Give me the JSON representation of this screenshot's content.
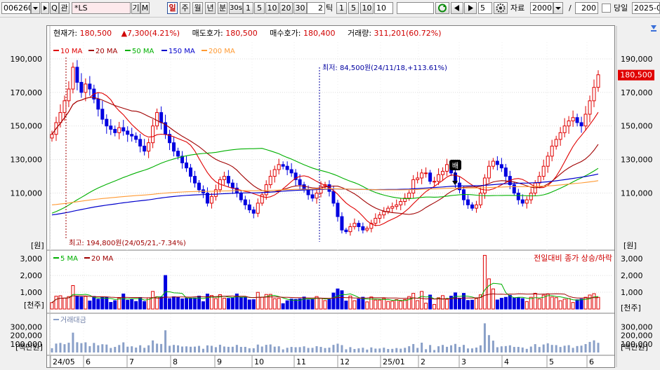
{
  "toolbar": {
    "code": "006260",
    "search_icon_glyph": "Q",
    "interest_label": "관",
    "stock_name": "*LS",
    "btn_gi": "기",
    "btn_m": "M",
    "periods": [
      "일",
      "주",
      "월",
      "년",
      "분",
      "30s"
    ],
    "selected_period": "일",
    "minute_values": [
      "1",
      "5",
      "10",
      "20",
      "30"
    ],
    "tick_input": "2",
    "tick_label": "틱",
    "tick_values": [
      "1",
      "5",
      "10"
    ],
    "tick_value2": "10",
    "blank_input": "",
    "nav_value": "5",
    "data_label": "자료",
    "data_count": "2000",
    "slash": "/",
    "view_count": "200",
    "today_label": "당일",
    "date": "2025-0"
  },
  "info": {
    "price_label": "현재가:",
    "price": "180,500",
    "change": "7,300(4.21%)",
    "ask_label": "매도호가:",
    "ask": "180,500",
    "bid_label": "매수호가:",
    "bid": "180,400",
    "volume_label": "거래량:",
    "volume": "311,201(60.72%)"
  },
  "colors": {
    "up": "#e00000",
    "down": "#0000e0",
    "ma10": "#e00000",
    "ma20": "#a00000",
    "ma50": "#00b000",
    "ma150": "#0000cc",
    "ma200": "#ff9a33"
  },
  "chart_data": [
    {
      "type": "candlestick",
      "title": "",
      "legend": [
        "10 MA",
        "20 MA",
        "50 MA",
        "150 MA",
        "200 MA"
      ],
      "ylabel": "[원]",
      "ylim": [
        81000,
        200000
      ],
      "y_ticks": [
        "190,000",
        "170,000",
        "150,000",
        "130,000",
        "110,000"
      ],
      "y_tick_values": [
        190000,
        170000,
        150000,
        130000,
        110000
      ],
      "current_price_tag": "180,500",
      "current_price_value": 180500,
      "annotations": {
        "low": "최저: 84,500원(24/11/18,+113.61%)",
        "high": "최고: 194,800원(24/05/21,-7.34%)",
        "marker": "배"
      },
      "x_labels": [
        "24/05",
        "6",
        "7",
        "8",
        "9",
        "10",
        "11",
        "12",
        "25/01",
        "2",
        "3",
        "4",
        "5",
        "6"
      ],
      "close_series": [
        145000,
        152000,
        158000,
        165000,
        172000,
        185000,
        176000,
        170000,
        175000,
        172000,
        166000,
        160000,
        154000,
        150000,
        148000,
        146000,
        149000,
        147000,
        145000,
        144000,
        142000,
        138000,
        135000,
        140000,
        150000,
        158000,
        152000,
        145000,
        140000,
        135000,
        132000,
        128000,
        125000,
        120000,
        116000,
        112000,
        110000,
        104000,
        108000,
        112000,
        118000,
        120000,
        116000,
        113000,
        110000,
        106000,
        103000,
        100000,
        98000,
        104000,
        109000,
        115000,
        120000,
        124000,
        127000,
        126000,
        124000,
        122000,
        118000,
        115000,
        112000,
        109000,
        107000,
        110000,
        114000,
        115000,
        111000,
        104000,
        96000,
        88000,
        87000,
        90000,
        92000,
        90000,
        88000,
        89000,
        92000,
        95000,
        97000,
        99000,
        101000,
        102000,
        103000,
        105000,
        107000,
        110000,
        118000,
        119000,
        122000,
        122000,
        117000,
        117000,
        121000,
        123000,
        127000,
        122000,
        116000,
        112000,
        106000,
        103000,
        101000,
        103000,
        110000,
        119000,
        126000,
        129000,
        127000,
        125000,
        120000,
        115000,
        110000,
        106000,
        104000,
        106000,
        110000,
        116000,
        120000,
        126000,
        132000,
        138000,
        142000,
        146000,
        150000,
        153000,
        155000,
        152000,
        150000,
        157000,
        165000,
        173000,
        180500
      ]
    },
    {
      "type": "bar",
      "title": "",
      "legend": [
        "5 MA",
        "20 MA"
      ],
      "right_label": "전일대비 종가 상승/하락",
      "ylabel": "[천주]",
      "ylim": [
        0,
        3300
      ],
      "y_ticks": [
        "3,000",
        "2,000",
        "1,000"
      ],
      "y_tick_values": [
        3000,
        2000,
        1000
      ]
    },
    {
      "type": "bar",
      "title": "",
      "legend": [
        "거래대금"
      ],
      "ylabel": "[백만원]",
      "ylim": [
        0,
        420000
      ],
      "y_ticks": [
        "300,000",
        "200,000",
        "100,000"
      ],
      "y_tick_values": [
        300000,
        200000,
        100000
      ]
    }
  ],
  "right_unit": "[원]"
}
